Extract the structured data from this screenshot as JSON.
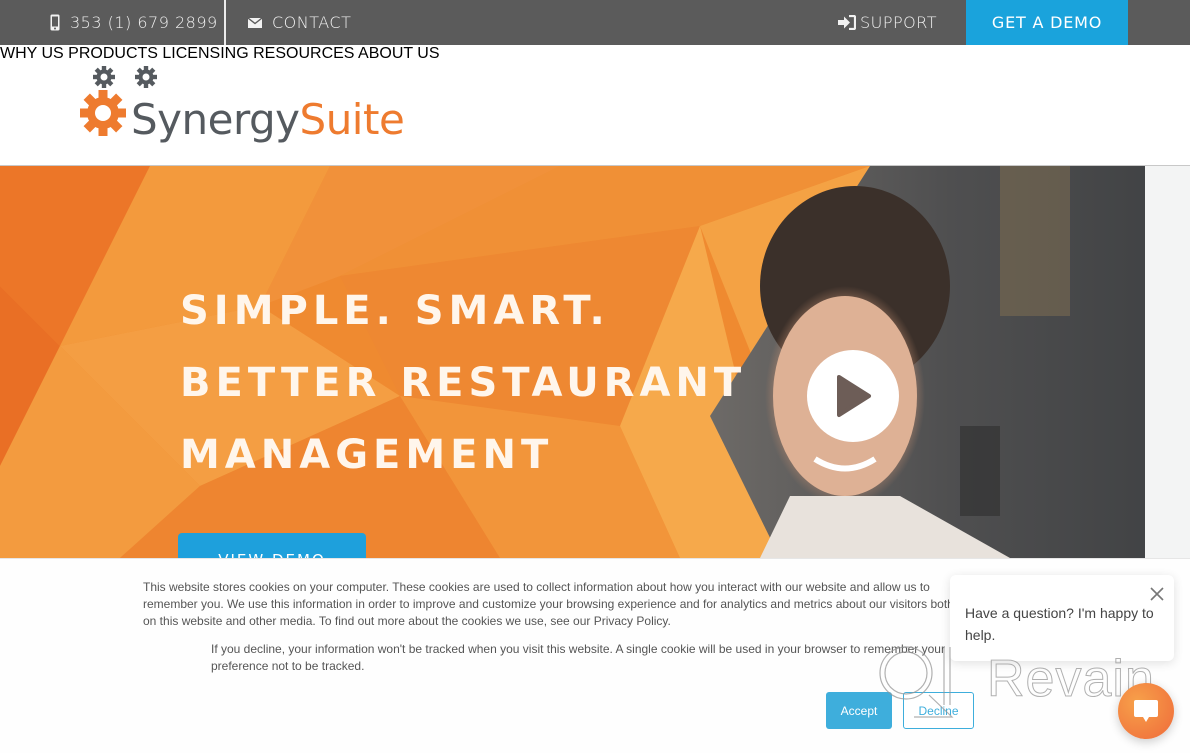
{
  "topbar": {
    "phone_icon": "mobile-phone-icon",
    "phone": "353 (1) 679 2899",
    "contact_icon": "envelope-icon",
    "contact": "CONTACT",
    "support_icon": "sign-in-icon",
    "support": "SUPPORT",
    "demo": "GET A DEMO"
  },
  "header": {
    "logo": {
      "part1": "Synergy",
      "part2": "Suite",
      "icon": "gears-icon"
    },
    "nav": [
      {
        "label": "WHY US"
      },
      {
        "label": "PRODUCTS"
      },
      {
        "label": "LICENSING"
      },
      {
        "label": "RESOURCES"
      },
      {
        "label": "ABOUT US"
      }
    ]
  },
  "hero": {
    "headline": [
      "SIMPLE. SMART.",
      "BETTER RESTAURANT",
      "MANAGEMENT"
    ],
    "cta": "VIEW DEMO",
    "play_icon": "play-icon"
  },
  "cookie": {
    "text1": "This website stores cookies on your computer. These cookies are used to collect information about how you interact with our website and allow us to remember you. We use this information in order to improve and customize your browsing experience and for analytics and metrics about our visitors both on this website and other media. To find out more about the cookies we use, see our Privacy Policy.",
    "text2": "If you decline, your information won't be tracked when you visit this website. A single cookie will be used in your browser to remember your preference not to be tracked.",
    "accept": "Accept",
    "decline": "Decline"
  },
  "chat": {
    "message": "Have a question? I'm happy to help.",
    "close_icon": "close-icon",
    "launcher_icon": "chat-bubble-icon"
  },
  "watermark": {
    "text": "Revain"
  },
  "colors": {
    "topbar_bg": "#5b5b5b",
    "accent_blue": "#1aa3dc",
    "brand_orange": "#ee7b2f",
    "logo_gray": "#555a5f"
  }
}
